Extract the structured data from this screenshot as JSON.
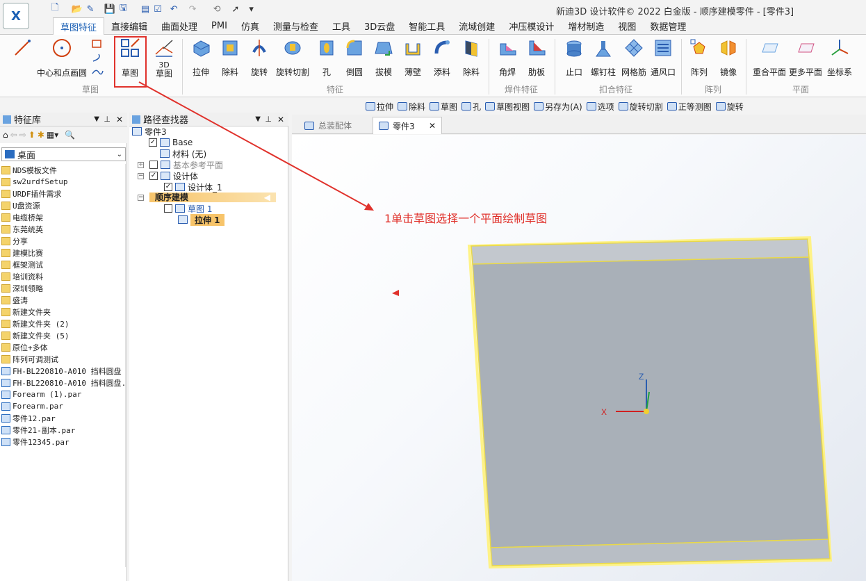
{
  "app": {
    "logo_text": "X",
    "window_title": "新迪3D 设计软件© 2022 白金版 - 顺序建模零件 - [零件3]"
  },
  "tabs": [
    "草图特征",
    "直接编辑",
    "曲面处理",
    "PMI",
    "仿真",
    "测量与检查",
    "工具",
    "3D云盘",
    "智能工具",
    "流域创建",
    "冲压模设计",
    "增材制造",
    "视图",
    "数据管理"
  ],
  "ribbon": {
    "buttons": {
      "circle": "中心和点画圆",
      "sketch": "草图",
      "sketch3d_a": "3D",
      "sketch3d_b": "草图",
      "extrude": "拉伸",
      "cut": "除料",
      "revolve": "旋转",
      "revolve_cut": "旋转切割",
      "hole": "孔",
      "round": "倒圆",
      "draft": "拔模",
      "thin_wall": "薄壁",
      "add": "添料",
      "remove": "除料",
      "fillet_weld": "角焊",
      "rib": "肋板",
      "stop": "止口",
      "boss": "螺钉柱",
      "grid_rib": "网格筋",
      "vent": "通风口",
      "pattern": "阵列",
      "mirror": "镜像",
      "coincident_plane": "重合平面",
      "more_planes": "更多平面",
      "coord_sys": "坐标系"
    },
    "groups": {
      "sketch": "草图",
      "feature": "特征",
      "weld": "焊件特征",
      "snap": "扣合特征",
      "pattern": "阵列",
      "plane": "平面"
    }
  },
  "subtoolbar": [
    "拉伸",
    "除料",
    "草图",
    "孔",
    "草图视图",
    "另存为(A)",
    "选项",
    "旋转切割",
    "正等测图",
    "旋转"
  ],
  "feature_library": {
    "title": "特征库",
    "location": "桌面",
    "items": [
      {
        "name": "NDS模板文件",
        "type": "folder"
      },
      {
        "name": "sw2urdfSetup",
        "type": "folder"
      },
      {
        "name": "URDF插件需求",
        "type": "folder"
      },
      {
        "name": "U盘资源",
        "type": "folder"
      },
      {
        "name": "电缆桥架",
        "type": "folder"
      },
      {
        "name": "东莞统英",
        "type": "folder"
      },
      {
        "name": "分享",
        "type": "folder"
      },
      {
        "name": "建模比赛",
        "type": "folder"
      },
      {
        "name": "框架测试",
        "type": "folder"
      },
      {
        "name": "培训资料",
        "type": "folder"
      },
      {
        "name": "深圳领略",
        "type": "folder"
      },
      {
        "name": "盛涛",
        "type": "folder"
      },
      {
        "name": "新建文件夹",
        "type": "folder"
      },
      {
        "name": "新建文件夹 (2)",
        "type": "folder"
      },
      {
        "name": "新建文件夹 (5)",
        "type": "folder"
      },
      {
        "name": "原位+多体",
        "type": "folder"
      },
      {
        "name": "阵列可调测试",
        "type": "folder"
      },
      {
        "name": "FH-BL220810-A010 挡料圆盘",
        "type": "file"
      },
      {
        "name": "FH-BL220810-A010 挡料圆盘.:",
        "type": "file"
      },
      {
        "name": "Forearm (1).par",
        "type": "file"
      },
      {
        "name": "Forearm.par",
        "type": "file"
      },
      {
        "name": "零件12.par",
        "type": "file"
      },
      {
        "name": "零件21-副本.par",
        "type": "file"
      },
      {
        "name": "零件12345.par",
        "type": "file"
      }
    ]
  },
  "path_finder": {
    "title": "路径查找器",
    "part": "零件3",
    "base": "Base",
    "material": "材料 (无)",
    "ref_planes": "基本参考平面",
    "design_body": "设计体",
    "design_body_1": "设计体_1",
    "ordered": "顺序建模",
    "sketch1": "草图 1",
    "extrude1": "拉伸 1"
  },
  "doc_tabs": {
    "assembly": "总装配体",
    "part": "零件3",
    "close": "✕"
  },
  "annotation": "1单击草图选择一个平面绘制草图",
  "axes": {
    "x": "X",
    "z": "Z"
  },
  "colors": {
    "accent": "#1a5fb4",
    "annotation": "#e0322c",
    "part_face": "#a9b0b8",
    "highlight": "#fff27a"
  }
}
